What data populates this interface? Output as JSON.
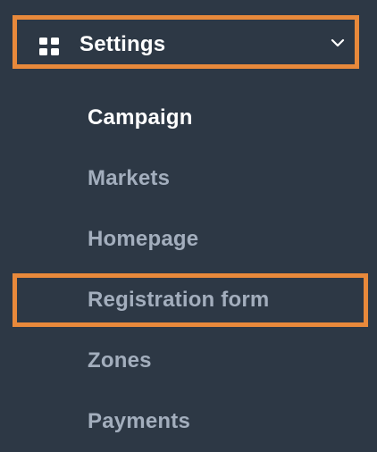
{
  "colors": {
    "background": "#2d3845",
    "highlight": "#e8893b",
    "active_text": "#ffffff",
    "inactive_text": "#a3aebd"
  },
  "header": {
    "icon": "grid-icon",
    "label": "Settings",
    "chevron": "chevron-down-icon"
  },
  "menu": {
    "items": [
      {
        "label": "Campaign",
        "active": true
      },
      {
        "label": "Markets",
        "active": false
      },
      {
        "label": "Homepage",
        "active": false
      },
      {
        "label": "Registration form",
        "active": false
      },
      {
        "label": "Zones",
        "active": false
      },
      {
        "label": "Payments",
        "active": false
      }
    ]
  }
}
